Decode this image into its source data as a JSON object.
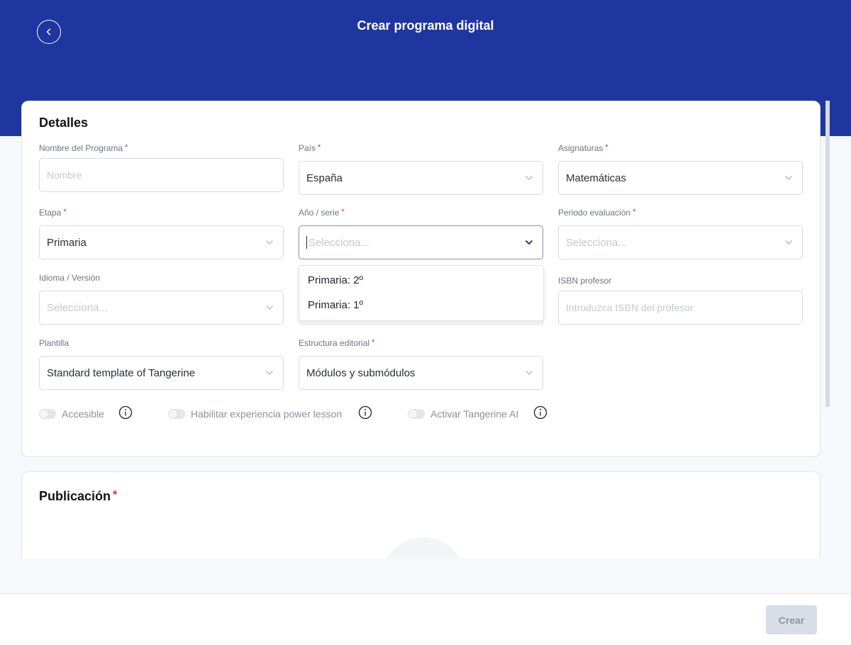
{
  "header": {
    "title": "Crear programa digital",
    "back_icon": "chevron-left-icon",
    "background_color": "#1f35a0"
  },
  "details": {
    "title": "Detalles",
    "required_mark": "*",
    "fields": {
      "program_name": {
        "label": "Nombre del Programa",
        "placeholder": "Nombre",
        "value": ""
      },
      "country": {
        "label": "País",
        "value": "España"
      },
      "subjects": {
        "label": "Asignaturas",
        "value": "Matemáticas"
      },
      "stage": {
        "label": "Etapa",
        "value": "Primaria"
      },
      "year_series": {
        "label": "Año / serie",
        "placeholder": "Selecciona...",
        "value": ""
      },
      "evaluation_period": {
        "label": "Periodo evaluación",
        "placeholder": "Selecciona...",
        "value": ""
      },
      "language_version": {
        "label": "Idioma / Versión",
        "placeholder": "Selecciona...",
        "value": ""
      },
      "teacher_isbn": {
        "label": "ISBN profesor",
        "placeholder": "Introduzca ISBN del profesor",
        "value": ""
      },
      "template": {
        "label": "Plantilla",
        "value": "Standard template of Tangerine"
      },
      "editorial_structure": {
        "label": "Estructura editorial",
        "value": "Módulos y submódulos"
      }
    },
    "year_series_options": [
      "Primaria: 2º",
      "Primaria: 1º"
    ],
    "toggles": [
      {
        "label": "Accesible",
        "enabled": false
      },
      {
        "label": "Habilitar experiencia power lesson",
        "enabled": false
      },
      {
        "label": "Activar Tangerine AI",
        "enabled": false
      }
    ]
  },
  "publication": {
    "title": "Publicación",
    "required_mark": "*"
  },
  "footer": {
    "create_label": "Crear"
  }
}
